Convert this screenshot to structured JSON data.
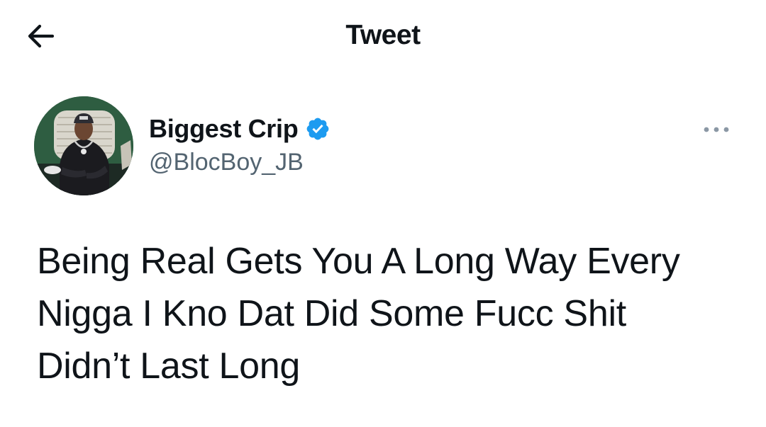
{
  "header": {
    "title": "Tweet",
    "back_icon": "arrow-left-icon"
  },
  "author": {
    "display_name": "Biggest Crip",
    "handle": "@BlocBoy_JB",
    "verified": true,
    "verified_icon": "verified-badge-icon",
    "avatar_icon": "user-avatar-photo"
  },
  "more_icon": "more-horizontal-icon",
  "tweet": {
    "lines": [
      "Being Real Gets You A Long Way Every",
      "Nigga I Kno Dat Did Some Fucc Shit",
      "Didn’t Last Long"
    ]
  },
  "colors": {
    "text": "#0f1419",
    "secondary_text": "#536471",
    "verified_blue": "#1d9bf0",
    "background": "#ffffff"
  }
}
